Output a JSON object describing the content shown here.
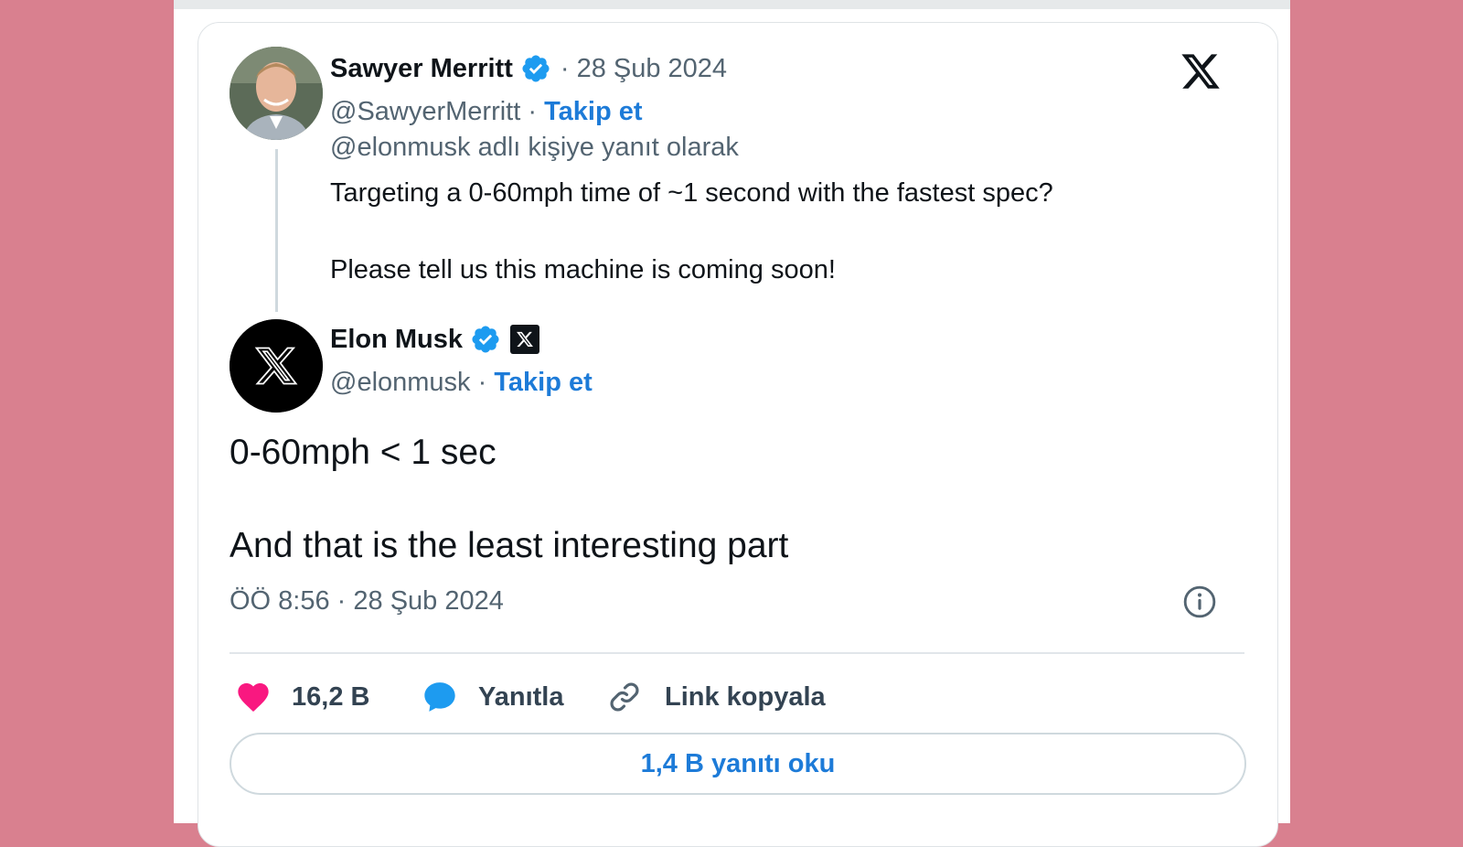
{
  "quoted_tweet": {
    "author_name": "Sawyer Merritt",
    "date": "· 28 Şub 2024",
    "handle": "@SawyerMerritt",
    "separator": " · ",
    "follow_label": "Takip et",
    "reply_context": "@elonmusk adlı kişiye yanıt olarak",
    "text_line1": "Targeting a 0-60mph time of ~1 second with the fastest spec?",
    "text_line2": "Please tell us this machine is coming soon!"
  },
  "main_tweet": {
    "author_name": "Elon Musk",
    "handle": "@elonmusk",
    "separator": " · ",
    "follow_label": "Takip et",
    "text_line1": "0-60mph < 1 sec",
    "text_line2": "And that is the least interesting part",
    "timestamp": "ÖÖ 8:56 · 28 Şub 2024"
  },
  "actions": {
    "like_count": "16,2 B",
    "reply_label": "Yanıtla",
    "copy_link_label": "Link kopyala"
  },
  "read_replies_label": "1,4 B yanıtı oku",
  "icons": [
    "x-logo-icon",
    "verified-badge-icon",
    "affiliate-x-badge-icon",
    "info-icon",
    "heart-icon",
    "reply-bubble-icon",
    "link-icon"
  ],
  "colors": {
    "background": "#d9808f",
    "accent_blue": "#1d7bd8",
    "like_pink": "#f91880",
    "verified_blue": "#1d9bf0"
  }
}
